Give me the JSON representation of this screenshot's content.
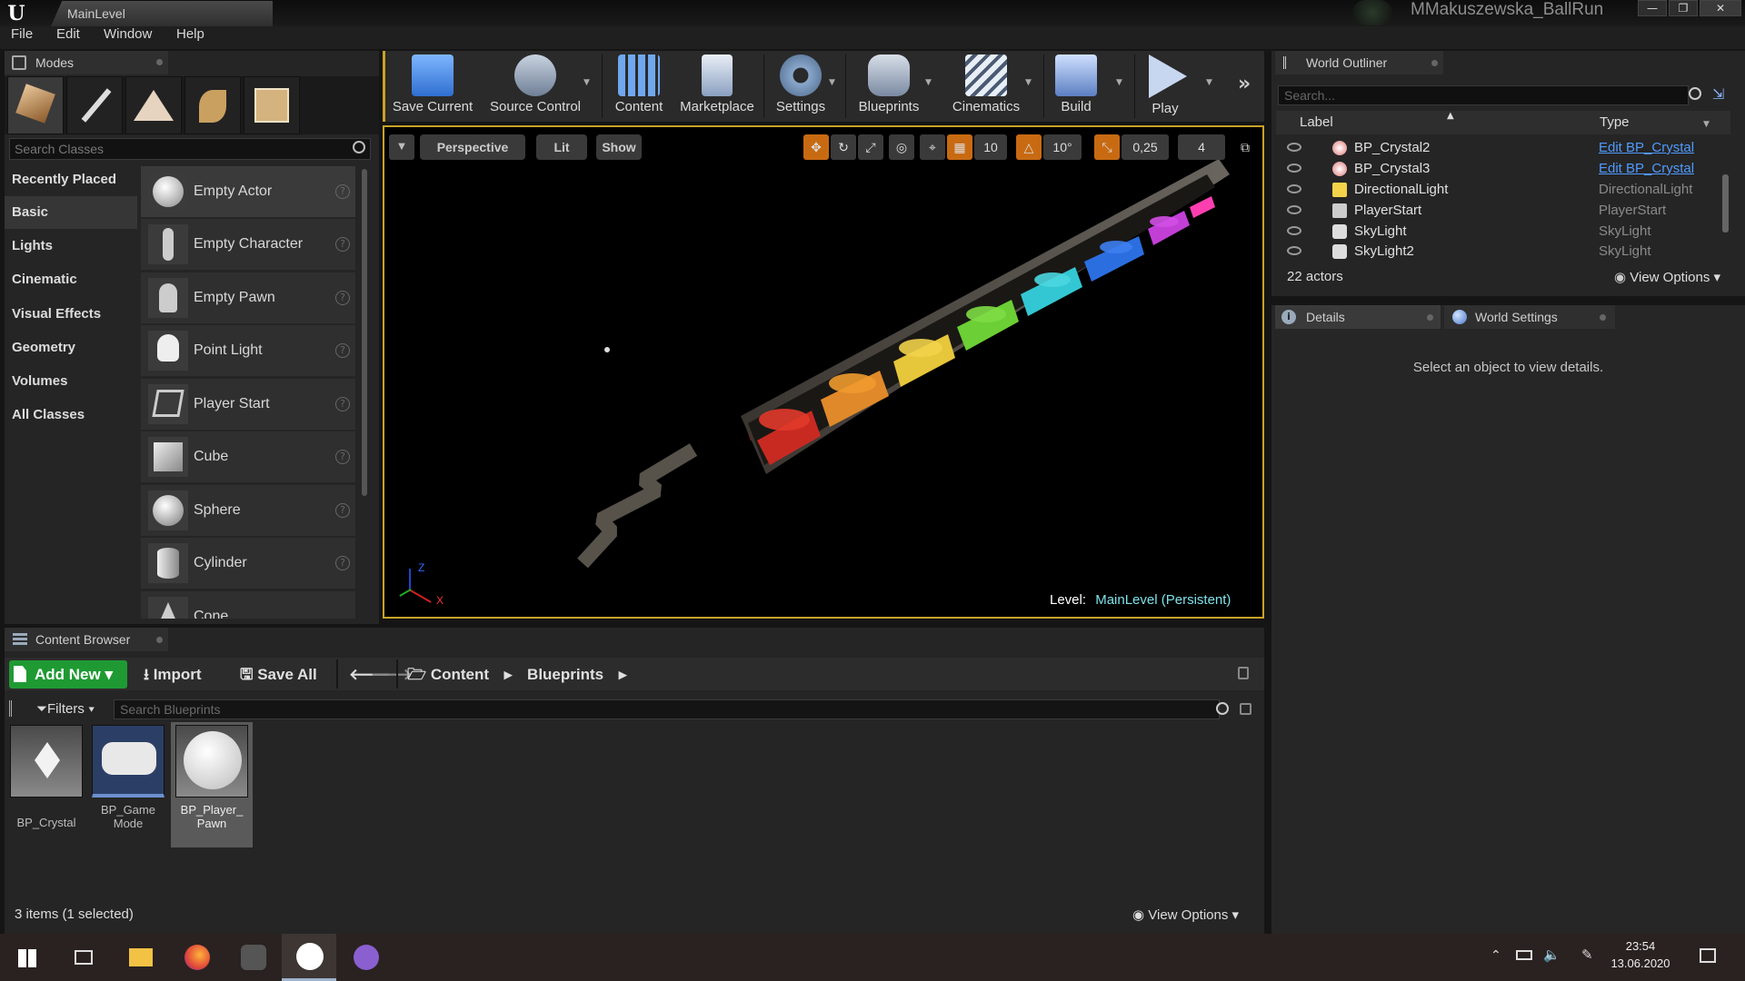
{
  "window": {
    "doc_tab": "MainLevel",
    "project_name": "MMakuszewska_BallRun",
    "controls": [
      "—",
      "❐",
      "✕"
    ]
  },
  "menubar": [
    "File",
    "Edit",
    "Window",
    "Help"
  ],
  "modes": {
    "title": "Modes",
    "search_placeholder": "Search Classes",
    "categories": [
      "Recently Placed",
      "Basic",
      "Lights",
      "Cinematic",
      "Visual Effects",
      "Geometry",
      "Volumes",
      "All Classes"
    ],
    "selected_category": "Basic",
    "items": [
      "Empty Actor",
      "Empty Character",
      "Empty Pawn",
      "Point Light",
      "Player Start",
      "Cube",
      "Sphere",
      "Cylinder",
      "Cone"
    ]
  },
  "toolbar": {
    "buttons": [
      "Save Current",
      "Source Control",
      "Content",
      "Marketplace",
      "Settings",
      "Blueprints",
      "Cinematics",
      "Build",
      "Play"
    ]
  },
  "viewport": {
    "perspective": "Perspective",
    "lit": "Lit",
    "show": "Show",
    "grid_snap": "10",
    "rotation_snap": "10°",
    "scale_snap": "0,25",
    "camera_speed": "4",
    "level_prefix": "Level:",
    "level_name": "MainLevel (Persistent)",
    "axis_z": "Z",
    "axis_x": "X"
  },
  "outliner": {
    "title": "World Outliner",
    "search_placeholder": "Search...",
    "col_label": "Label",
    "col_type": "Type",
    "rows": [
      {
        "label": "BP_Crystal2",
        "type": "Edit BP_Crystal",
        "link": true
      },
      {
        "label": "BP_Crystal3",
        "type": "Edit BP_Crystal",
        "link": true
      },
      {
        "label": "DirectionalLight",
        "type": "DirectionalLight",
        "link": false
      },
      {
        "label": "PlayerStart",
        "type": "PlayerStart",
        "link": false
      },
      {
        "label": "SkyLight",
        "type": "SkyLight",
        "link": false
      },
      {
        "label": "SkyLight2",
        "type": "SkyLight",
        "link": false
      }
    ],
    "actor_count": "22 actors",
    "view_options": "View Options"
  },
  "details": {
    "tab_details": "Details",
    "tab_world_settings": "World Settings",
    "empty_message": "Select an object to view details."
  },
  "content_browser": {
    "title": "Content Browser",
    "add_new": "Add New",
    "import": "Import",
    "save_all": "Save All",
    "path": [
      "Content",
      "Blueprints"
    ],
    "filters": "Filters",
    "search_placeholder": "Search Blueprints",
    "assets": [
      {
        "name": "BP_Crystal"
      },
      {
        "name": "BP_Game Mode"
      },
      {
        "name": "BP_Player_ Pawn"
      }
    ],
    "status": "3 items (1 selected)",
    "view_options": "View Options"
  },
  "taskbar": {
    "time": "23:54",
    "date": "13.06.2020"
  },
  "colors": {
    "accent_gold": "#c9a227",
    "add_new_green": "#1f9a33",
    "link_blue": "#4f9bff"
  }
}
